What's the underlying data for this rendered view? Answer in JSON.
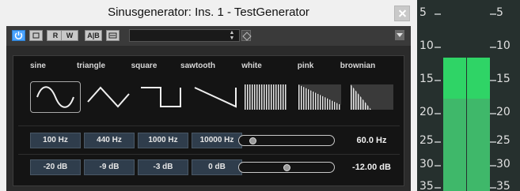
{
  "window": {
    "title": "Sinusgenerator: Ins. 1 - TestGenerator"
  },
  "toolbar": {
    "buttons": [
      "R",
      "W",
      "A|B"
    ],
    "preset_value": ""
  },
  "waveforms": [
    {
      "label": "sine",
      "selected": true
    },
    {
      "label": "triangle",
      "selected": false
    },
    {
      "label": "square",
      "selected": false
    },
    {
      "label": "sawtooth",
      "selected": false
    },
    {
      "label": "white",
      "selected": false
    },
    {
      "label": "pink",
      "selected": false
    },
    {
      "label": "brownian",
      "selected": false
    }
  ],
  "frequency": {
    "presets": [
      "100 Hz",
      "440 Hz",
      "1000 Hz",
      "10000 Hz"
    ],
    "readout": "60.0 Hz",
    "slider_level": 0.1
  },
  "level": {
    "presets": [
      "-20 dB",
      "-9 dB",
      "-3 dB",
      "0 dB"
    ],
    "readout": "-12.00 dB",
    "slider_level": 0.5
  },
  "meter": {
    "scale": [
      "5",
      "10",
      "15",
      "20",
      "25",
      "30",
      "35"
    ],
    "colors": {
      "bar": "#3fb86a",
      "peak": "#2fd466"
    }
  }
}
